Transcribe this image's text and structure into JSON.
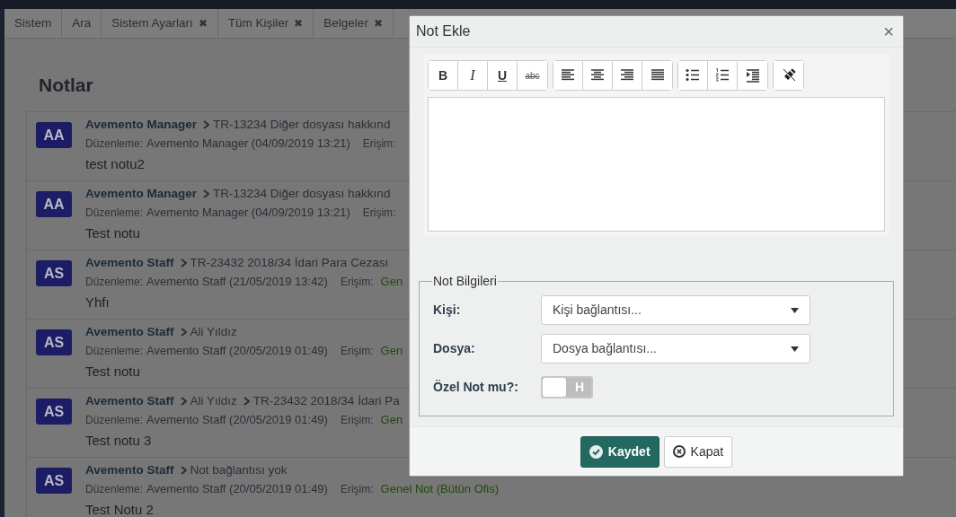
{
  "tabs": [
    {
      "label": "Sistem",
      "selected": false
    },
    {
      "label": "Ara",
      "selected": false
    },
    {
      "label": "Sistem Ayarları",
      "close": "✖",
      "selected": false
    },
    {
      "label": "Tüm Kişiler",
      "close": "✖",
      "selected": false
    },
    {
      "label": "Belgeler",
      "close": "✖",
      "selected": false
    }
  ],
  "page_title": "Notlar",
  "notes": [
    {
      "initials": "AA",
      "author": "Avemento Manager",
      "links": [
        "TR-13234 Diğer dosyası hakkınd"
      ],
      "edited_label": "Düzenleme:",
      "edited_by": "Avemento Manager (04/09/2019 13:21)",
      "access_label": "Erişim:",
      "text": "test notu2"
    },
    {
      "initials": "AA",
      "author": "Avemento Manager",
      "links": [
        "TR-13234 Diğer dosyası hakkınd"
      ],
      "edited_label": "Düzenleme:",
      "edited_by": "Avemento Manager (04/09/2019 13:21)",
      "access_label": "Erişim:",
      "text": "Test notu"
    },
    {
      "initials": "AS",
      "author": "Avemento Staff",
      "links": [
        "TR-23432 2018/34 İdari Para Cezası"
      ],
      "edited_label": "Düzenleme:",
      "edited_by": "Avemento Staff (21/05/2019 13:42)",
      "access_label": "Erişim:",
      "access": "Gen",
      "text": "Yhfı"
    },
    {
      "initials": "AS",
      "author": "Avemento Staff",
      "links": [
        "Ali Yıldız"
      ],
      "edited_label": "Düzenleme:",
      "edited_by": "Avemento Staff (20/05/2019 01:49)",
      "access_label": "Erişim:",
      "access": "Gen",
      "text": "Test notu"
    },
    {
      "initials": "AS",
      "author": "Avemento Staff",
      "links": [
        "Ali Yıldız",
        "TR-23432 2018/34 İdari Pa"
      ],
      "edited_label": "Düzenleme:",
      "edited_by": "Avemento Staff (20/05/2019 01:49)",
      "access_label": "Erişim:",
      "access": "Gen",
      "text": "Test notu 3"
    },
    {
      "initials": "AS",
      "author": "Avemento Staff",
      "links": [
        "Not bağlantısı yok"
      ],
      "edited_label": "Düzenleme:",
      "edited_by": "Avemento Staff (20/05/2019 01:49)",
      "access_label": "Erişim:",
      "access": "Genel Not (Bütün Ofis)",
      "text": "Test Notu 2"
    }
  ],
  "dialog": {
    "title": "Not Ekle",
    "close": "×",
    "toolbar": [
      {
        "kind": "format",
        "labels": [
          "B",
          "I",
          "U",
          "abc"
        ]
      },
      {
        "kind": "align"
      },
      {
        "kind": "list"
      },
      {
        "kind": "clear"
      }
    ],
    "fieldset": {
      "legend": "Not Bilgileri",
      "fields": [
        {
          "kind": "select",
          "label": "Kişi:",
          "placeholder": "Kişi bağlantısı..."
        },
        {
          "kind": "select",
          "label": "Dosya:",
          "placeholder": "Dosya bağlantısı..."
        },
        {
          "kind": "switch",
          "label": "Özel Not mu?:",
          "on": false,
          "off_text": "H"
        }
      ]
    },
    "buttons": [
      {
        "kind": "primary",
        "label": "Kaydet"
      },
      {
        "kind": "secondary",
        "label": "Kapat"
      }
    ]
  }
}
